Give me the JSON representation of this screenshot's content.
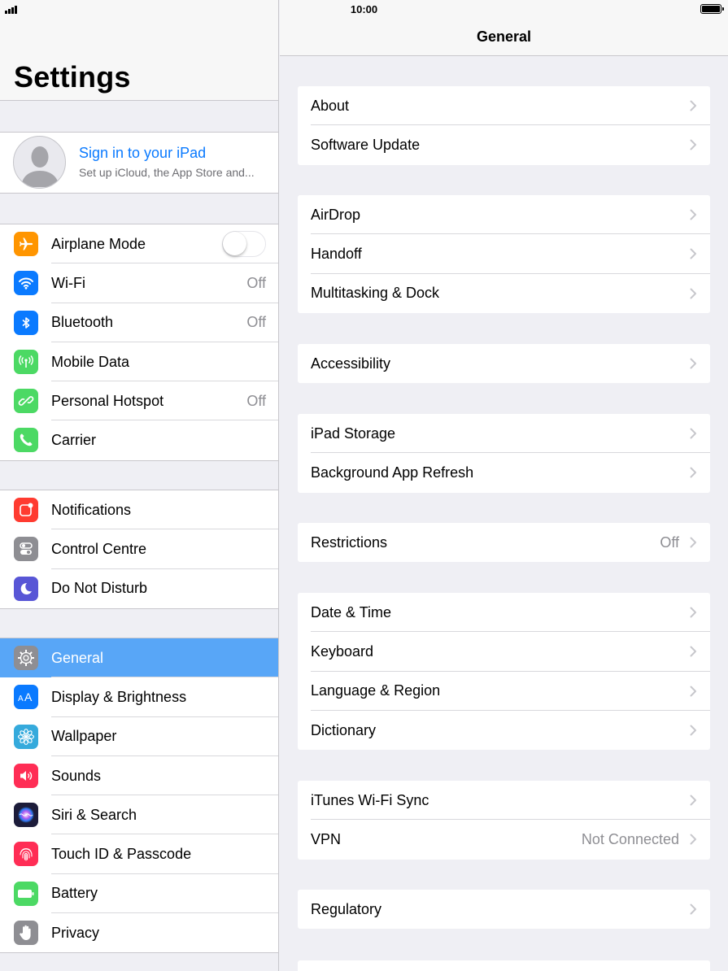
{
  "status_bar": {
    "time": "10:00"
  },
  "sidebar": {
    "title": "Settings",
    "profile": {
      "title": "Sign in to your iPad",
      "subtitle": "Set up iCloud, the App Store and..."
    },
    "groups": [
      [
        {
          "label": "Airplane Mode",
          "value": "",
          "icon": "airplane-icon",
          "color": "#ff9500"
        },
        {
          "label": "Wi-Fi",
          "value": "Off",
          "icon": "wifi-icon",
          "color": "#0a7aff"
        },
        {
          "label": "Bluetooth",
          "value": "Off",
          "icon": "bluetooth-icon",
          "color": "#0a7aff"
        },
        {
          "label": "Mobile Data",
          "value": "",
          "icon": "antenna-icon",
          "color": "#4cd964"
        },
        {
          "label": "Personal Hotspot",
          "value": "Off",
          "icon": "hotspot-icon",
          "color": "#4cd964"
        },
        {
          "label": "Carrier",
          "value": "",
          "icon": "phone-icon",
          "color": "#4cd964"
        }
      ],
      [
        {
          "label": "Notifications",
          "value": "",
          "icon": "notifications-icon",
          "color": "#ff3b30"
        },
        {
          "label": "Control Centre",
          "value": "",
          "icon": "control-centre-icon",
          "color": "#8e8e93"
        },
        {
          "label": "Do Not Disturb",
          "value": "",
          "icon": "moon-icon",
          "color": "#5856d6"
        }
      ],
      [
        {
          "label": "General",
          "value": "",
          "icon": "gear-icon",
          "color": "#8e8e93",
          "selected": true
        },
        {
          "label": "Display & Brightness",
          "value": "",
          "icon": "text-size-icon",
          "color": "#0a7aff"
        },
        {
          "label": "Wallpaper",
          "value": "",
          "icon": "flower-icon",
          "color": "#35aadc"
        },
        {
          "label": "Sounds",
          "value": "",
          "icon": "speaker-icon",
          "color": "#ff2d55"
        },
        {
          "label": "Siri & Search",
          "value": "",
          "icon": "siri-icon",
          "color": "#1c1c3a"
        },
        {
          "label": "Touch ID & Passcode",
          "value": "",
          "icon": "fingerprint-icon",
          "color": "#ff2d55"
        },
        {
          "label": "Battery",
          "value": "",
          "icon": "battery-icon",
          "color": "#4cd964"
        },
        {
          "label": "Privacy",
          "value": "",
          "icon": "hand-icon",
          "color": "#8e8e93"
        }
      ]
    ]
  },
  "main": {
    "title": "General",
    "groups": [
      [
        {
          "label": "About",
          "value": ""
        },
        {
          "label": "Software Update",
          "value": ""
        }
      ],
      [
        {
          "label": "AirDrop",
          "value": ""
        },
        {
          "label": "Handoff",
          "value": ""
        },
        {
          "label": "Multitasking & Dock",
          "value": ""
        }
      ],
      [
        {
          "label": "Accessibility",
          "value": ""
        }
      ],
      [
        {
          "label": "iPad Storage",
          "value": ""
        },
        {
          "label": "Background App Refresh",
          "value": ""
        }
      ],
      [
        {
          "label": "Restrictions",
          "value": "Off"
        }
      ],
      [
        {
          "label": "Date & Time",
          "value": ""
        },
        {
          "label": "Keyboard",
          "value": ""
        },
        {
          "label": "Language & Region",
          "value": ""
        },
        {
          "label": "Dictionary",
          "value": ""
        }
      ],
      [
        {
          "label": "iTunes Wi-Fi Sync",
          "value": ""
        },
        {
          "label": "VPN",
          "value": "Not Connected"
        }
      ],
      [
        {
          "label": "Regulatory",
          "value": ""
        }
      ],
      [
        {
          "label": "",
          "value": ""
        }
      ]
    ]
  }
}
